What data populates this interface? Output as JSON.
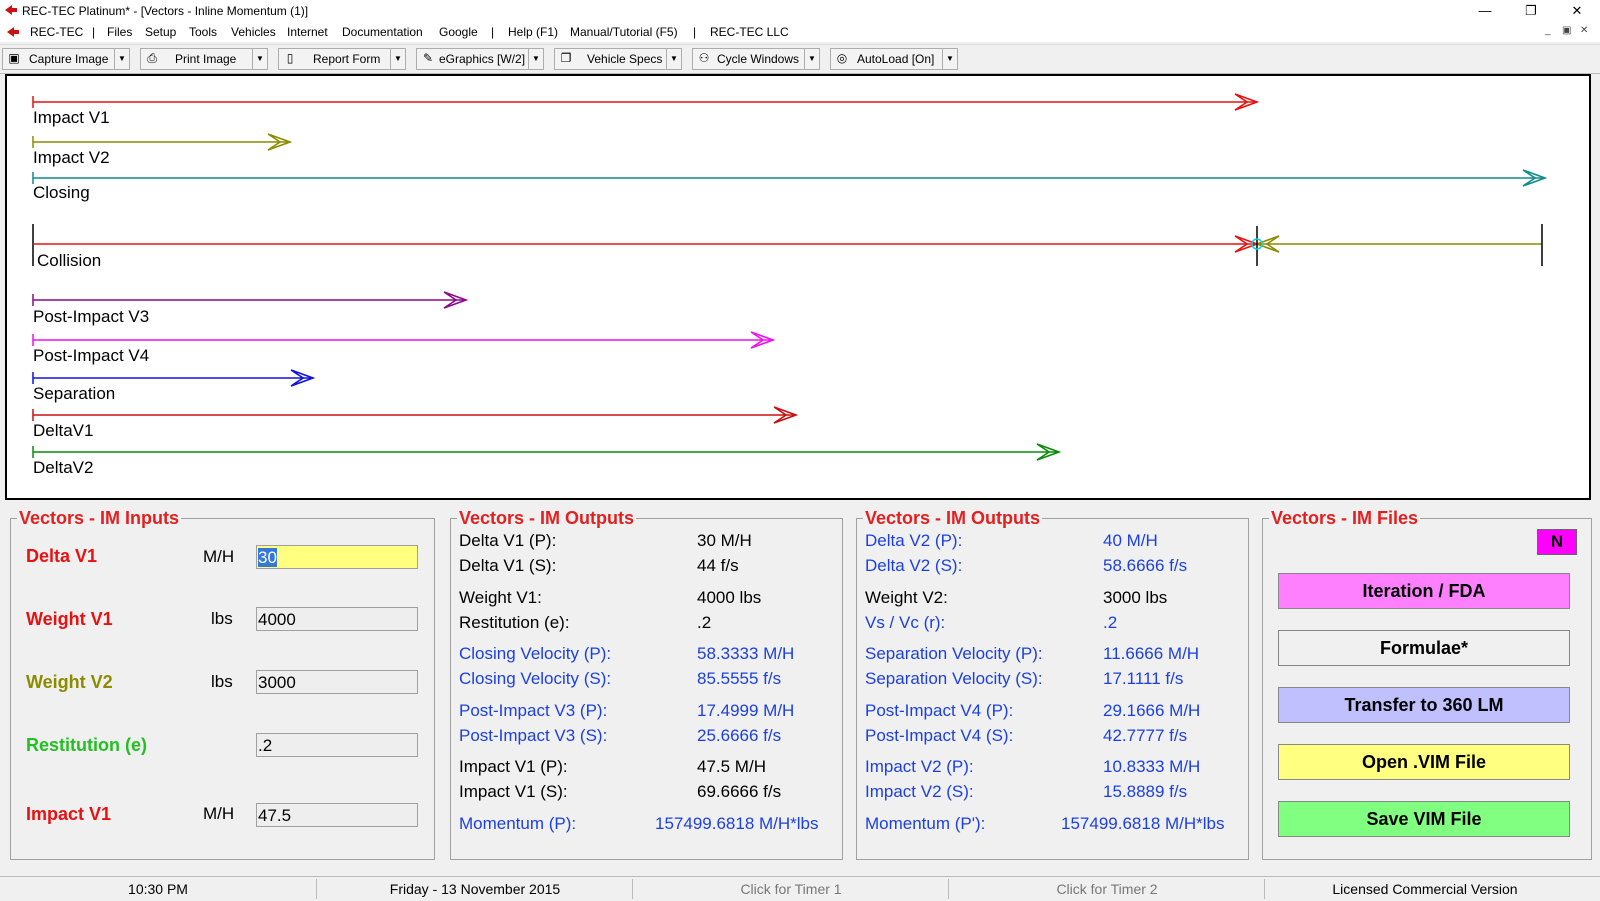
{
  "window": {
    "title": "REC-TEC Platinum* - [Vectors - Inline Momentum (1)]",
    "minimize": "—",
    "restore": "❐",
    "close": "✕"
  },
  "menu": {
    "items": [
      "REC-TEC",
      "|",
      "Files",
      "Setup",
      "Tools",
      "Vehicles",
      "Internet",
      "Documentation",
      "Google",
      "|",
      "Help (F1)",
      "Manual/Tutorial (F5)",
      "|",
      "REC-TEC LLC"
    ],
    "mdi_min": "_",
    "mdi_restore": "▣",
    "mdi_close": "✕"
  },
  "toolbar": {
    "capture": "Capture Image",
    "print": "Print Image",
    "report": "Report Form",
    "egraphics": "eGraphics [W/2]",
    "vehicle_specs": "Vehicle Specs",
    "cycle": "Cycle Windows",
    "autoload": "AutoLoad [On]",
    "dropdown_glyph": "▼"
  },
  "vectors": {
    "impact_v1": "Impact V1",
    "impact_v2": "Impact V2",
    "closing": "Closing",
    "collision": "Collision",
    "post_v3": "Post-Impact V3",
    "post_v4": "Post-Impact V4",
    "separation": "Separation",
    "delta_v1": "DeltaV1",
    "delta_v2": "DeltaV2",
    "colors": {
      "impact_v1": "#e81010",
      "impact_v2": "#8c8c00",
      "closing": "#0e8c8c",
      "collision_left": "#e81010",
      "collision_right": "#8c8c00",
      "post_v3": "#8c0a8c",
      "post_v4": "#f010f0",
      "separation": "#1010e0",
      "delta_v1": "#c81010",
      "delta_v2": "#0a8c0a"
    }
  },
  "inputs": {
    "title": "Vectors - IM Inputs",
    "delta_v1_label": "Delta V1",
    "delta_v1_unit": "M/H",
    "delta_v1_value": "30",
    "weight_v1_label": "Weight V1",
    "weight_v1_unit": "lbs",
    "weight_v1_value": "4000",
    "weight_v2_label": "Weight V2",
    "weight_v2_unit": "lbs",
    "weight_v2_value": "3000",
    "restitution_label": "Restitution (e)",
    "restitution_value": ".2",
    "impact_v1_label": "Impact V1",
    "impact_v1_unit": "M/H",
    "impact_v1_value": "47.5"
  },
  "outputs1": {
    "title": "Vectors - IM Outputs",
    "rows": [
      {
        "label": "Delta V1 (P):",
        "value": "30  M/H"
      },
      {
        "label": "Delta V1 (S):",
        "value": "44  f/s"
      },
      {
        "label": "Weight V1:",
        "value": "4000  lbs"
      },
      {
        "label": "Restitution (e):",
        "value": ".2"
      },
      {
        "label": "Closing Velocity (P):",
        "value": "58.3333  M/H"
      },
      {
        "label": "Closing Velocity (S):",
        "value": "85.5555  f/s"
      },
      {
        "label": "Post-Impact V3 (P):",
        "value": "17.4999  M/H"
      },
      {
        "label": "Post-Impact V3 (S):",
        "value": "25.6666  f/s"
      },
      {
        "label": "Impact V1 (P):",
        "value": "47.5  M/H"
      },
      {
        "label": "Impact V1 (S):",
        "value": "69.6666  f/s"
      },
      {
        "label": "Momentum (P):",
        "value": "157499.6818  M/H*lbs"
      }
    ]
  },
  "outputs2": {
    "title": "Vectors - IM Outputs",
    "rows": [
      {
        "label": "Delta V2 (P):",
        "value": "40  M/H"
      },
      {
        "label": "Delta V2 (S):",
        "value": "58.6666  f/s"
      },
      {
        "label": "Weight V2:",
        "value": "3000  lbs"
      },
      {
        "label": "Vs / Vc (r):",
        "value": ".2"
      },
      {
        "label": "Separation Velocity (P):",
        "value": "11.6666  M/H"
      },
      {
        "label": "Separation Velocity (S):",
        "value": "17.1111  f/s"
      },
      {
        "label": "Post-Impact V4 (P):",
        "value": "29.1666  M/H"
      },
      {
        "label": "Post-Impact V4 (S):",
        "value": "42.7777  f/s"
      },
      {
        "label": "Impact V2 (P):",
        "value": "10.8333  M/H"
      },
      {
        "label": "Impact V2 (S):",
        "value": "15.8889  f/s"
      },
      {
        "label": "Momentum (P'):",
        "value": "157499.6818  M/H*lbs"
      }
    ]
  },
  "files": {
    "title": "Vectors - IM Files",
    "badge": "N",
    "iteration": "Iteration / FDA",
    "formulae": "Formulae*",
    "transfer": "Transfer to 360 LM",
    "open": "Open .VIM File",
    "save": "Save VIM File",
    "colors": {
      "iteration": "#ff80ff",
      "formulae": "#f0f0f0",
      "transfer": "#c0c0ff",
      "open": "#ffff80",
      "save": "#80ff80"
    }
  },
  "status": {
    "time": "10:30 PM",
    "date": "Friday  -  13 November 2015",
    "timer1": "Click for Timer 1",
    "timer2": "Click for Timer 2",
    "license": "Licensed Commercial Version"
  }
}
